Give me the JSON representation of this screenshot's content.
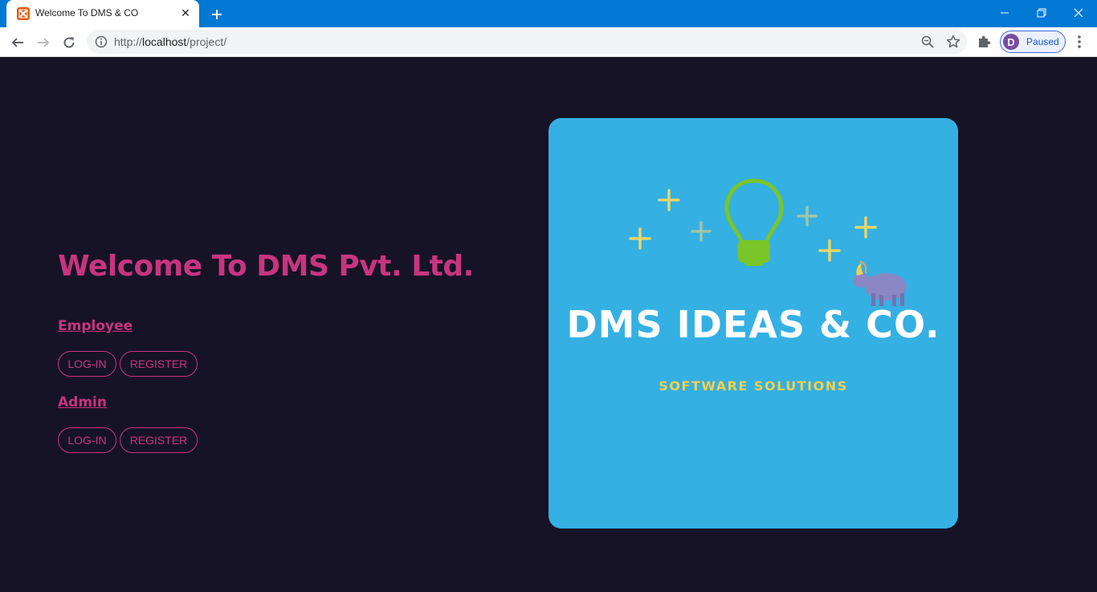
{
  "browser": {
    "tab_title": "Welcome To DMS & CO",
    "url_scheme": "http://",
    "url_host": "localhost",
    "url_path": "/project/",
    "profile_initial": "D",
    "profile_label": "Paused"
  },
  "main": {
    "heading": "Welcome To DMS Pvt. Ltd.",
    "sections": [
      {
        "label": "Employee",
        "login_label": "LOG-IN",
        "register_label": "REGISTER"
      },
      {
        "label": "Admin",
        "login_label": "LOG-IN",
        "register_label": "REGISTER"
      }
    ]
  },
  "logo": {
    "title": "DMS IDEAS & CO.",
    "subtitle": "SOFTWARE SOLUTIONS",
    "colors": {
      "background": "#35b0e3",
      "bulb": "#79c52a",
      "accent": "#f4d04a"
    }
  },
  "theme": {
    "page_background": "#161326",
    "accent": "#c7357f",
    "titlebar": "#0078d4"
  }
}
